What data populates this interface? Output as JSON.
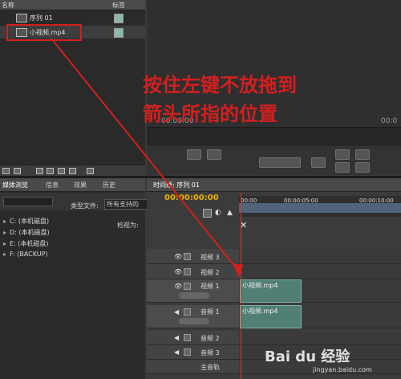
{
  "project_panel": {
    "col_name": "名称",
    "col_label": "标签",
    "items": [
      {
        "label": "序列 01",
        "selected": false
      },
      {
        "label": "小视频.mp4",
        "selected": true
      }
    ]
  },
  "monitor": {
    "timecode_left": "00:00:00",
    "timecode_right": "00:0"
  },
  "media_browser": {
    "tabs": [
      "媒体浏览",
      "信息",
      "效果",
      "历史"
    ],
    "file_type_label": "类型文件:",
    "file_type_value": "所有支持的",
    "view_as_label": "检视为:",
    "drives": [
      "C: (本机磁盘)",
      "D: (本机磁盘)",
      "E: (本机磁盘)",
      "F: (BACKUP)"
    ]
  },
  "timeline": {
    "tab_label": "时间线: 序列 01",
    "timecode": "00:00:00:00",
    "ruler_labels": [
      "00:00",
      "00:00:05:00",
      "00:00:10:00"
    ],
    "tracks": {
      "video3": "视频 3",
      "video2": "视频 2",
      "video1": "视频 1",
      "audio1": "音频 1",
      "audio2": "音频 2",
      "audio3": "音频 3",
      "master": "主音轨"
    },
    "video_clip": "小视频.mp4",
    "audio_clip": "小视频.mp4"
  },
  "annotation": {
    "line1": "按住左键不放拖到",
    "line2": "箭头所指的位置",
    "color": "#d41f1f"
  },
  "watermark": {
    "brand": "Bai du 经验",
    "url": "jingyan.baidu.com"
  }
}
